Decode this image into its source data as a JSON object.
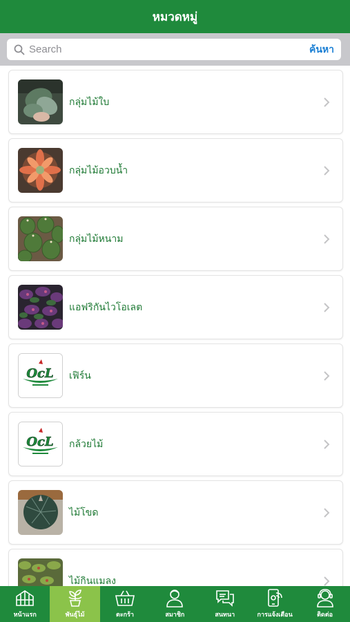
{
  "header": {
    "title": "หมวดหมู่"
  },
  "search": {
    "placeholder": "Search",
    "value": "",
    "button_label": "ค้นหา"
  },
  "categories": [
    {
      "label": "กลุ่มไม้ใบ",
      "thumb_icon": "leaf-plant-photo"
    },
    {
      "label": "กลุ่มไม้อวบน้ำ",
      "thumb_icon": "succulent-photo"
    },
    {
      "label": "กลุ่มไม้หนาม",
      "thumb_icon": "cactus-photo"
    },
    {
      "label": "แอฟริกันไวโอเลต",
      "thumb_icon": "violet-photo"
    },
    {
      "label": "เฟิร์น",
      "thumb_icon": "ocl-logo"
    },
    {
      "label": "กล้วยไม้",
      "thumb_icon": "ocl-logo"
    },
    {
      "label": "ไม้โขด",
      "thumb_icon": "caudex-leaf-photo"
    },
    {
      "label": "ไม้กินแมลง",
      "thumb_icon": "carnivorous-plant-photo"
    }
  ],
  "tabbar": {
    "items": [
      {
        "label": "หน้าแรก",
        "icon": "greenhouse-icon",
        "active": false
      },
      {
        "label": "พันธุ์ไม้",
        "icon": "plant-icon",
        "active": true
      },
      {
        "label": "ตะกร้า",
        "icon": "basket-icon",
        "active": false
      },
      {
        "label": "สมาชิก",
        "icon": "member-icon",
        "active": false
      },
      {
        "label": "สนทนา",
        "icon": "chat-icon",
        "active": false
      },
      {
        "label": "การแจ้งเตือน",
        "icon": "notification-phone-icon",
        "active": false
      },
      {
        "label": "ติดต่อ",
        "icon": "contact-icon",
        "active": false
      }
    ]
  },
  "colors": {
    "brand_green": "#1f8a3c",
    "active_tab": "#8bc34a",
    "label_green": "#1f7a35",
    "search_accent": "#1a7fd4"
  }
}
